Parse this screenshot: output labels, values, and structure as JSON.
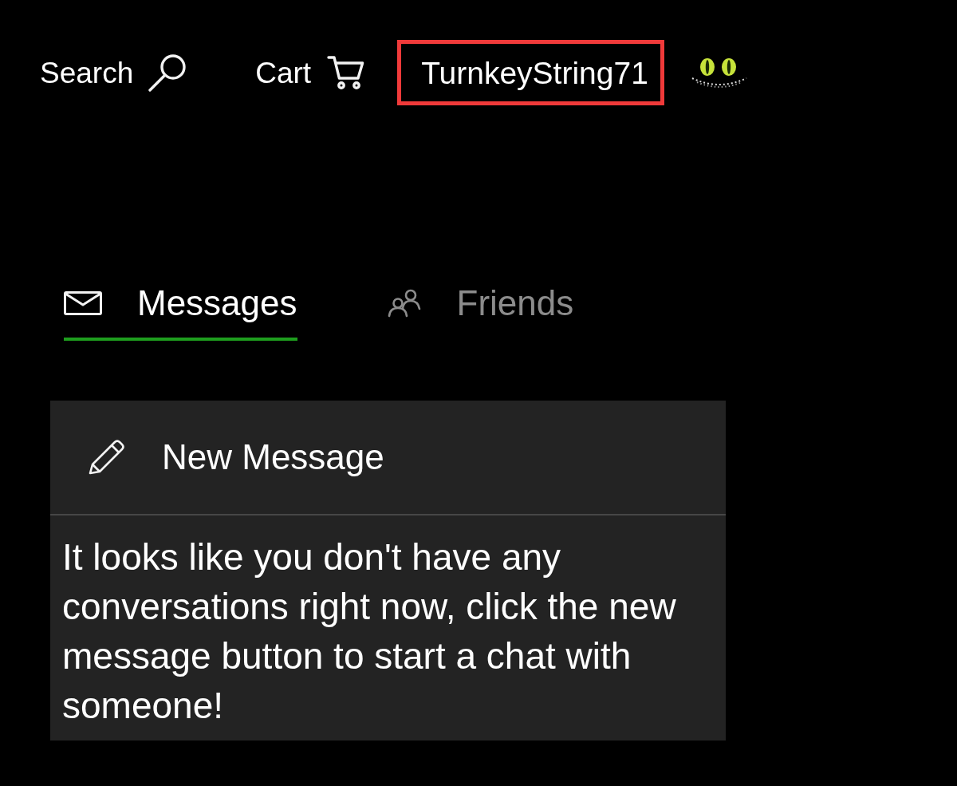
{
  "nav": {
    "search_label": "Search",
    "cart_label": "Cart",
    "username": "TurnkeyString71",
    "username_highlighted": true
  },
  "tabs": [
    {
      "label": "Messages",
      "selected": true
    },
    {
      "label": "Friends",
      "selected": false
    }
  ],
  "panel": {
    "new_message_label": "New Message",
    "empty_text": "It looks like you don't have any conversations right now, click the new message button to start a chat with someone!"
  }
}
